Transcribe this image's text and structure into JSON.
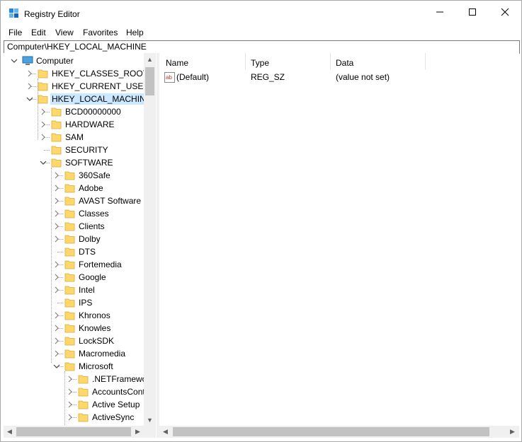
{
  "window": {
    "title": "Registry Editor",
    "controls": {
      "minimize": "minimize",
      "maximize": "maximize",
      "close": "close"
    }
  },
  "menu": [
    "File",
    "Edit",
    "View",
    "Favorites",
    "Help"
  ],
  "address": "Computer\\HKEY_LOCAL_MACHINE",
  "tree": {
    "root": "Computer",
    "hives": [
      "HKEY_CLASSES_ROOT",
      "HKEY_CURRENT_USER",
      "HKEY_LOCAL_MACHINE"
    ],
    "hklm_children": [
      "BCD00000000",
      "HARDWARE",
      "SAM",
      "SECURITY",
      "SOFTWARE"
    ],
    "software_children": [
      "360Safe",
      "Adobe",
      "AVAST Software",
      "Classes",
      "Clients",
      "Dolby",
      "DTS",
      "Fortemedia",
      "Google",
      "Intel",
      "IPS",
      "Khronos",
      "Knowles",
      "LockSDK",
      "Macromedia",
      "Microsoft"
    ],
    "microsoft_children": [
      ".NETFramewor",
      "AccountsCont",
      "Active Setup",
      "ActiveSync"
    ],
    "selected": "HKEY_LOCAL_MACHINE"
  },
  "list": {
    "headers": {
      "name": "Name",
      "type": "Type",
      "data": "Data"
    },
    "rows": [
      {
        "icon": "ab",
        "name": "(Default)",
        "type": "REG_SZ",
        "data": "(value not set)"
      }
    ]
  },
  "colors": {
    "selection": "#cce8ff",
    "folder": "#ffd86b",
    "accent": "#0078d7"
  }
}
